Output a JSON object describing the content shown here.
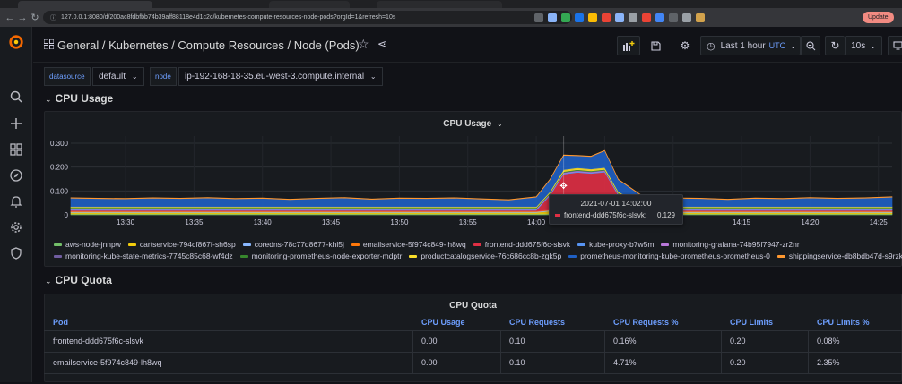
{
  "browser": {
    "url": "127.0.0.1:8080/d/200ac8fdbfbb74b39aff88118e4d1c2c/kubernetes-compute-resources-node-pods?orgId=1&refresh=10s",
    "update_label": "Update",
    "extension_colors": [
      "#5f6368",
      "#8ab4f8",
      "#34a853",
      "#1a73e8",
      "#fbbc04",
      "#ea4335",
      "#8ab4f8",
      "#9aa0a6",
      "#ea4335",
      "#4285f4",
      "#5f6368",
      "#9aa0a6",
      "#d2a24c"
    ]
  },
  "sidebar": {
    "icons": [
      "grafana-logo",
      "search-icon",
      "plus-icon",
      "dashboards-icon",
      "explore-icon",
      "alerting-icon",
      "configuration-icon",
      "shield-icon"
    ]
  },
  "header": {
    "breadcrumb": "General / Kubernetes / Compute Resources / Node (Pods)",
    "time_range": "Last 1 hour",
    "timezone": "UTC",
    "refresh": "10s"
  },
  "variables": [
    {
      "label": "datasource",
      "value": "default"
    },
    {
      "label": "node",
      "value": "ip-192-168-18-35.eu-west-3.compute.internal"
    }
  ],
  "rows": {
    "cpu_usage": "CPU Usage",
    "cpu_quota": "CPU Quota"
  },
  "cpu_usage_panel": {
    "title": "CPU Usage",
    "tooltip": {
      "time": "2021-07-01 14:02:00",
      "series": "frontend-ddd675f6c-slsvk:",
      "value": "0.129",
      "color": "#e02f44"
    }
  },
  "chart_data": {
    "type": "area",
    "stacked": true,
    "yticks": [
      "0",
      "0.100",
      "0.200",
      "0.300"
    ],
    "ylim": [
      0,
      0.33
    ],
    "xticks": [
      "13:30",
      "13:35",
      "13:40",
      "13:45",
      "13:50",
      "13:55",
      "14:00",
      "14:05",
      "14:10",
      "14:15",
      "14:20",
      "14:25"
    ],
    "x": [
      "13:26",
      "13:28",
      "13:30",
      "13:32",
      "13:34",
      "13:36",
      "13:38",
      "13:40",
      "13:42",
      "13:44",
      "13:46",
      "13:48",
      "13:50",
      "13:52",
      "13:54",
      "13:56",
      "13:58",
      "14:00",
      "14:01",
      "14:02",
      "14:03",
      "14:04",
      "14:05",
      "14:06",
      "14:08",
      "14:10",
      "14:12",
      "14:14",
      "14:16",
      "14:18",
      "14:20",
      "14:22",
      "14:24",
      "14:26"
    ],
    "series": [
      {
        "name": "aws-node-jnnpw",
        "color": "#73bf69",
        "values": [
          0.004,
          0.004,
          0.004,
          0.004,
          0.004,
          0.004,
          0.004,
          0.004,
          0.004,
          0.004,
          0.004,
          0.004,
          0.004,
          0.004,
          0.004,
          0.004,
          0.004,
          0.004,
          0.004,
          0.004,
          0.004,
          0.004,
          0.004,
          0.004,
          0.004,
          0.004,
          0.004,
          0.004,
          0.004,
          0.004,
          0.004,
          0.004,
          0.004,
          0.004
        ]
      },
      {
        "name": "cartservice-794cf867f-sh6sp",
        "color": "#f2cc0c",
        "values": [
          0.006,
          0.006,
          0.006,
          0.006,
          0.006,
          0.006,
          0.006,
          0.006,
          0.006,
          0.006,
          0.006,
          0.006,
          0.006,
          0.006,
          0.006,
          0.006,
          0.006,
          0.006,
          0.012,
          0.03,
          0.032,
          0.03,
          0.028,
          0.012,
          0.006,
          0.006,
          0.006,
          0.006,
          0.006,
          0.006,
          0.006,
          0.006,
          0.006,
          0.006
        ]
      },
      {
        "name": "coredns-78c77d8677-khl5j",
        "color": "#8ab8ff",
        "values": [
          0.003,
          0.003,
          0.003,
          0.003,
          0.003,
          0.003,
          0.003,
          0.003,
          0.003,
          0.003,
          0.003,
          0.003,
          0.003,
          0.003,
          0.003,
          0.003,
          0.003,
          0.003,
          0.003,
          0.003,
          0.003,
          0.003,
          0.003,
          0.003,
          0.003,
          0.003,
          0.003,
          0.003,
          0.003,
          0.003,
          0.003,
          0.003,
          0.003,
          0.003
        ]
      },
      {
        "name": "emailservice-5f974c849-lh8wq",
        "color": "#ff780a",
        "values": [
          0.002,
          0.002,
          0.002,
          0.002,
          0.002,
          0.002,
          0.002,
          0.002,
          0.002,
          0.002,
          0.002,
          0.002,
          0.002,
          0.002,
          0.002,
          0.002,
          0.002,
          0.002,
          0.002,
          0.004,
          0.004,
          0.004,
          0.004,
          0.002,
          0.002,
          0.002,
          0.002,
          0.002,
          0.002,
          0.002,
          0.002,
          0.002,
          0.002,
          0.002
        ]
      },
      {
        "name": "frontend-ddd675f6c-slsvk",
        "color": "#e02f44",
        "values": [
          0.004,
          0.004,
          0.004,
          0.004,
          0.004,
          0.004,
          0.004,
          0.004,
          0.004,
          0.004,
          0.004,
          0.004,
          0.004,
          0.004,
          0.004,
          0.004,
          0.004,
          0.004,
          0.06,
          0.129,
          0.135,
          0.132,
          0.14,
          0.06,
          0.004,
          0.004,
          0.004,
          0.004,
          0.004,
          0.004,
          0.004,
          0.004,
          0.004,
          0.004
        ]
      },
      {
        "name": "kube-proxy-b7w5m",
        "color": "#5794f2",
        "values": [
          0.003,
          0.003,
          0.003,
          0.003,
          0.003,
          0.003,
          0.003,
          0.003,
          0.003,
          0.003,
          0.003,
          0.003,
          0.003,
          0.003,
          0.003,
          0.003,
          0.003,
          0.003,
          0.003,
          0.003,
          0.003,
          0.003,
          0.003,
          0.003,
          0.003,
          0.003,
          0.003,
          0.003,
          0.003,
          0.003,
          0.003,
          0.003,
          0.003,
          0.003
        ]
      },
      {
        "name": "monitoring-grafana-74b95f7947-zr2nr",
        "color": "#b877d9",
        "values": [
          0.003,
          0.003,
          0.003,
          0.003,
          0.003,
          0.003,
          0.003,
          0.003,
          0.003,
          0.003,
          0.003,
          0.003,
          0.003,
          0.003,
          0.003,
          0.003,
          0.003,
          0.003,
          0.003,
          0.003,
          0.003,
          0.003,
          0.003,
          0.003,
          0.003,
          0.003,
          0.003,
          0.003,
          0.003,
          0.003,
          0.003,
          0.003,
          0.003,
          0.003
        ]
      },
      {
        "name": "monitoring-kube-state-metrics-7745c85c68-wf4dz",
        "color": "#705da0",
        "values": [
          0.002,
          0.002,
          0.002,
          0.002,
          0.002,
          0.002,
          0.002,
          0.002,
          0.002,
          0.002,
          0.002,
          0.002,
          0.002,
          0.002,
          0.002,
          0.002,
          0.002,
          0.002,
          0.002,
          0.002,
          0.002,
          0.002,
          0.002,
          0.002,
          0.002,
          0.002,
          0.002,
          0.002,
          0.002,
          0.002,
          0.002,
          0.002,
          0.002,
          0.002
        ]
      },
      {
        "name": "monitoring-prometheus-node-exporter-mdptr",
        "color": "#37872d",
        "values": [
          0.003,
          0.003,
          0.003,
          0.003,
          0.003,
          0.003,
          0.003,
          0.003,
          0.003,
          0.003,
          0.003,
          0.003,
          0.003,
          0.003,
          0.003,
          0.003,
          0.003,
          0.003,
          0.003,
          0.003,
          0.003,
          0.003,
          0.003,
          0.003,
          0.003,
          0.003,
          0.003,
          0.003,
          0.003,
          0.003,
          0.003,
          0.003,
          0.003,
          0.003
        ]
      },
      {
        "name": "productcatalogservice-76c686cc8b-zgk5p",
        "color": "#fade2a",
        "values": [
          0.004,
          0.004,
          0.004,
          0.004,
          0.004,
          0.004,
          0.004,
          0.004,
          0.004,
          0.004,
          0.004,
          0.004,
          0.004,
          0.004,
          0.004,
          0.004,
          0.004,
          0.004,
          0.005,
          0.008,
          0.008,
          0.008,
          0.008,
          0.005,
          0.004,
          0.004,
          0.004,
          0.004,
          0.004,
          0.004,
          0.004,
          0.004,
          0.004,
          0.004
        ]
      },
      {
        "name": "prometheus-monitoring-kube-prometheus-prometheus-0",
        "color": "#1f60c4",
        "values": [
          0.036,
          0.034,
          0.033,
          0.036,
          0.034,
          0.037,
          0.033,
          0.035,
          0.03,
          0.034,
          0.037,
          0.031,
          0.035,
          0.034,
          0.036,
          0.032,
          0.028,
          0.04,
          0.05,
          0.06,
          0.05,
          0.052,
          0.07,
          0.05,
          0.034,
          0.036,
          0.034,
          0.03,
          0.035,
          0.033,
          0.037,
          0.034,
          0.036,
          0.04
        ]
      },
      {
        "name": "shippingservice-db8bdb47d-s9rzk",
        "color": "#ff9830",
        "values": [
          0.002,
          0.002,
          0.002,
          0.002,
          0.002,
          0.002,
          0.002,
          0.002,
          0.002,
          0.002,
          0.002,
          0.002,
          0.002,
          0.002,
          0.002,
          0.002,
          0.002,
          0.002,
          0.002,
          0.002,
          0.002,
          0.002,
          0.002,
          0.002,
          0.002,
          0.002,
          0.002,
          0.002,
          0.002,
          0.002,
          0.002,
          0.002,
          0.002,
          0.002
        ]
      }
    ]
  },
  "cpu_quota_panel": {
    "title": "CPU Quota",
    "columns": [
      "Pod",
      "CPU Usage",
      "CPU Requests",
      "CPU Requests %",
      "CPU Limits",
      "CPU Limits %"
    ],
    "rows": [
      [
        "frontend-ddd675f6c-slsvk",
        "0.00",
        "0.10",
        "0.16%",
        "0.20",
        "0.08%"
      ],
      [
        "emailservice-5f974c849-lh8wq",
        "0.00",
        "0.10",
        "4.71%",
        "0.20",
        "2.35%"
      ]
    ]
  }
}
